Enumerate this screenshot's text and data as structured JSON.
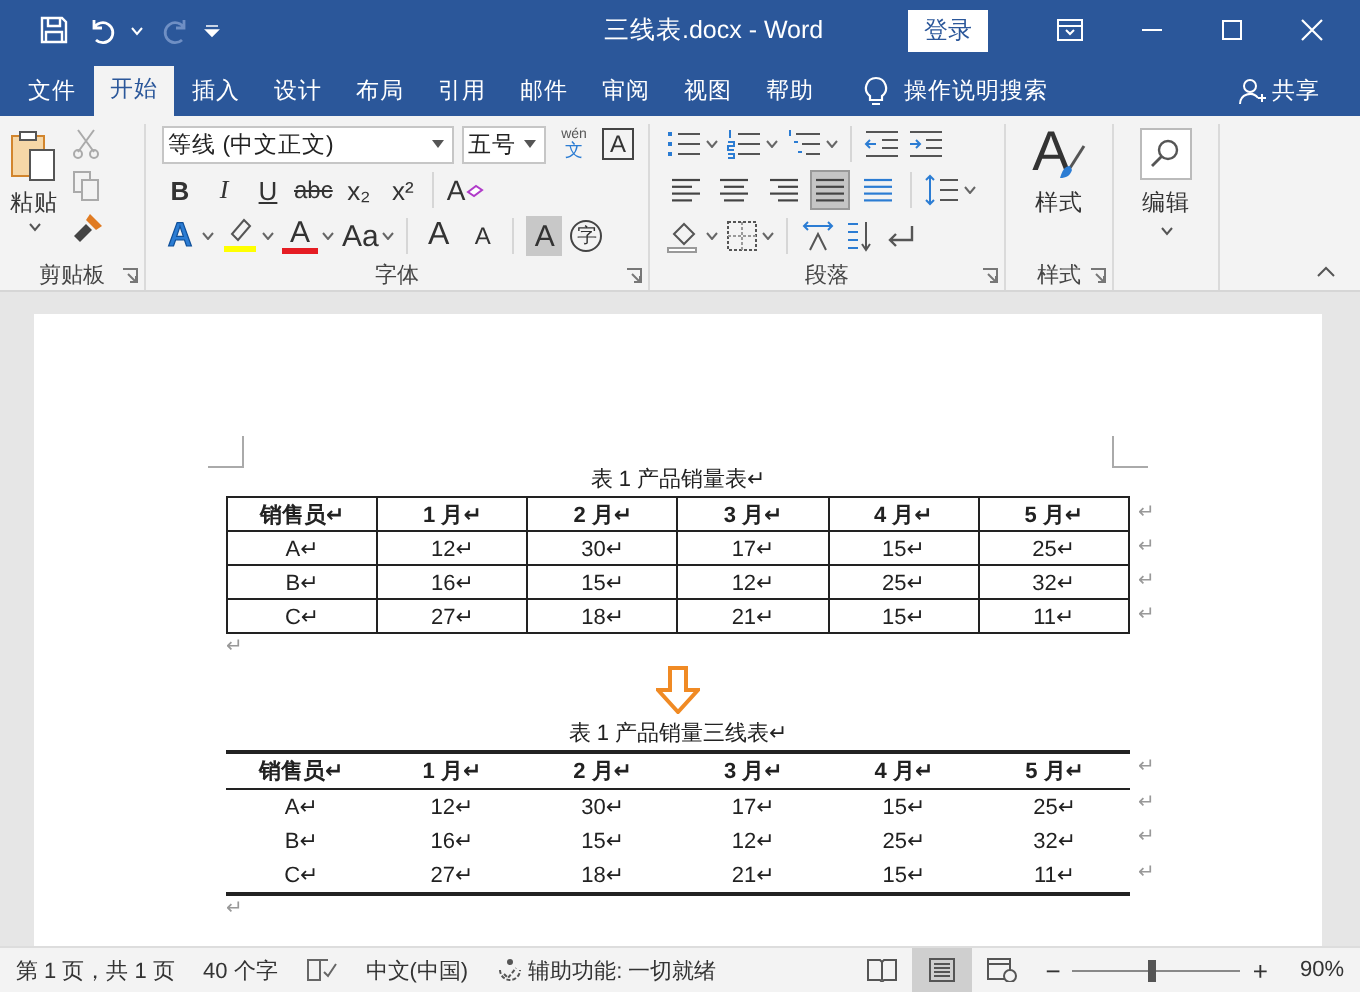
{
  "window": {
    "title": "三线表.docx  -  Word",
    "sign_in": "登录"
  },
  "tabs": [
    {
      "label": "文件",
      "selected": false
    },
    {
      "label": "开始",
      "selected": true
    },
    {
      "label": "插入",
      "selected": false
    },
    {
      "label": "设计",
      "selected": false
    },
    {
      "label": "布局",
      "selected": false
    },
    {
      "label": "引用",
      "selected": false
    },
    {
      "label": "邮件",
      "selected": false
    },
    {
      "label": "审阅",
      "selected": false
    },
    {
      "label": "视图",
      "selected": false
    },
    {
      "label": "帮助",
      "selected": false
    }
  ],
  "tell_me": "操作说明搜索",
  "share": "共享",
  "ribbon": {
    "clipboard": {
      "paste": "粘贴",
      "label": "剪贴板"
    },
    "font": {
      "font_name": "等线 (中文正文)",
      "font_size": "五号",
      "phonetic_top": "wén",
      "phonetic_bottom": "文",
      "border_char": "A",
      "format_buttons": [
        {
          "label": "B",
          "kind": "bold"
        },
        {
          "label": "I",
          "kind": "italic"
        },
        {
          "label": "U",
          "kind": "underline"
        },
        {
          "label": "abc",
          "kind": "strike"
        },
        {
          "label": "x₂",
          "kind": "plain"
        },
        {
          "label": "x²",
          "kind": "plain"
        }
      ],
      "clear_letter": "A",
      "effect_buttons": [
        {
          "label": "A",
          "kind": "outline"
        },
        {
          "kind": "highlight"
        },
        {
          "label": "A",
          "kind": "color"
        },
        {
          "label": "Aa",
          "kind": "case"
        },
        {
          "label": "A",
          "kind": "grow"
        },
        {
          "label": "A",
          "kind": "shrink"
        },
        {
          "label": "A",
          "kind": "shade"
        },
        {
          "label": "字",
          "kind": "enclose"
        }
      ],
      "label": "字体"
    },
    "paragraph": {
      "alignment": [
        {
          "selected": false
        },
        {
          "selected": false
        },
        {
          "selected": false
        },
        {
          "selected": true
        },
        {
          "selected": false
        }
      ],
      "label": "段落"
    },
    "styles": {
      "letter": "A",
      "button_label": "样式",
      "label": "样式"
    },
    "editing": {
      "label": "编辑"
    }
  },
  "document": {
    "blocks": [
      {
        "kind": "caption",
        "text": "表 1  产品销量表↵"
      },
      {
        "kind": "grid_table",
        "header": {
          "cells": [
            "销售员↵",
            "1 月↵",
            "2 月↵",
            "3 月↵",
            "4 月↵",
            "5 月↵"
          ],
          "end_mark": "↵"
        },
        "rows": [
          {
            "cells": [
              "A↵",
              "12↵",
              "30↵",
              "17↵",
              "15↵",
              "25↵"
            ],
            "end_mark": "↵"
          },
          {
            "cells": [
              "B↵",
              "16↵",
              "15↵",
              "12↵",
              "25↵",
              "32↵"
            ],
            "end_mark": "↵"
          },
          {
            "cells": [
              "C↵",
              "27↵",
              "18↵",
              "21↵",
              "15↵",
              "11↵"
            ],
            "end_mark": "↵"
          }
        ]
      },
      {
        "kind": "paragraph",
        "text": "↵"
      },
      {
        "kind": "arrow"
      },
      {
        "kind": "caption",
        "text": "表 1  产品销量三线表↵"
      },
      {
        "kind": "three_line_table",
        "header": {
          "cells": [
            "销售员↵",
            "1 月↵",
            "2 月↵",
            "3 月↵",
            "4 月↵",
            "5 月↵"
          ],
          "end_mark": "↵"
        },
        "rows": [
          {
            "cells": [
              "A↵",
              "12↵",
              "30↵",
              "17↵",
              "15↵",
              "25↵"
            ],
            "end_mark": "↵"
          },
          {
            "cells": [
              "B↵",
              "16↵",
              "15↵",
              "12↵",
              "25↵",
              "32↵"
            ],
            "end_mark": "↵"
          },
          {
            "cells": [
              "C↵",
              "27↵",
              "18↵",
              "21↵",
              "15↵",
              "11↵"
            ],
            "end_mark": "↵"
          }
        ]
      },
      {
        "kind": "paragraph",
        "text": "↵"
      }
    ]
  },
  "status_bar": {
    "page": "第 1 页，共 1 页",
    "words": "40 个字",
    "language": "中文(中国)",
    "accessibility": "辅助功能: 一切就绪",
    "views": [
      {
        "selected": false
      },
      {
        "selected": true
      },
      {
        "selected": false
      }
    ],
    "zoom": {
      "minus": "−",
      "plus": "+",
      "level": 0.47,
      "reading": "90%"
    }
  }
}
